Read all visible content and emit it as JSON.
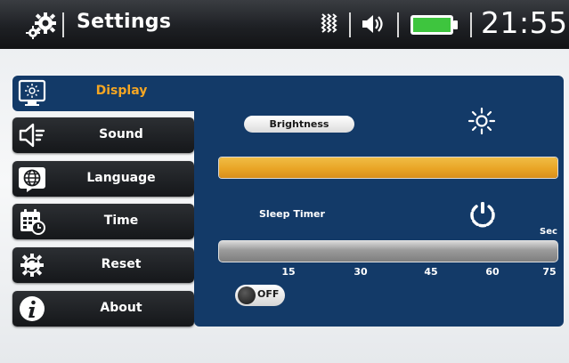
{
  "status_bar": {
    "title": "Settings",
    "time": "21:55",
    "battery_color": "#3ec53e"
  },
  "sidebar": {
    "items": [
      {
        "label": "Display",
        "icon": "monitor-brightness-icon",
        "active": true
      },
      {
        "label": "Sound",
        "icon": "speaker-icon",
        "active": false
      },
      {
        "label": "Language",
        "icon": "globe-icon",
        "active": false
      },
      {
        "label": "Time",
        "icon": "calendar-clock-icon",
        "active": false
      },
      {
        "label": "Reset",
        "icon": "reset-gear-icon",
        "active": false
      },
      {
        "label": "About",
        "icon": "info-icon",
        "active": false
      }
    ]
  },
  "display_panel": {
    "brightness_label": "Brightness",
    "brightness_level": 1.0,
    "sleep_timer_label": "Sleep Timer",
    "sleep_unit": "Sec",
    "sleep_ticks": [
      "15",
      "30",
      "45",
      "60",
      "75"
    ],
    "toggle_label": "OFF",
    "toggle_on": false
  },
  "colors": {
    "accent": "#f5a623",
    "panel": "#133a68",
    "active_text": "#f5a623"
  }
}
